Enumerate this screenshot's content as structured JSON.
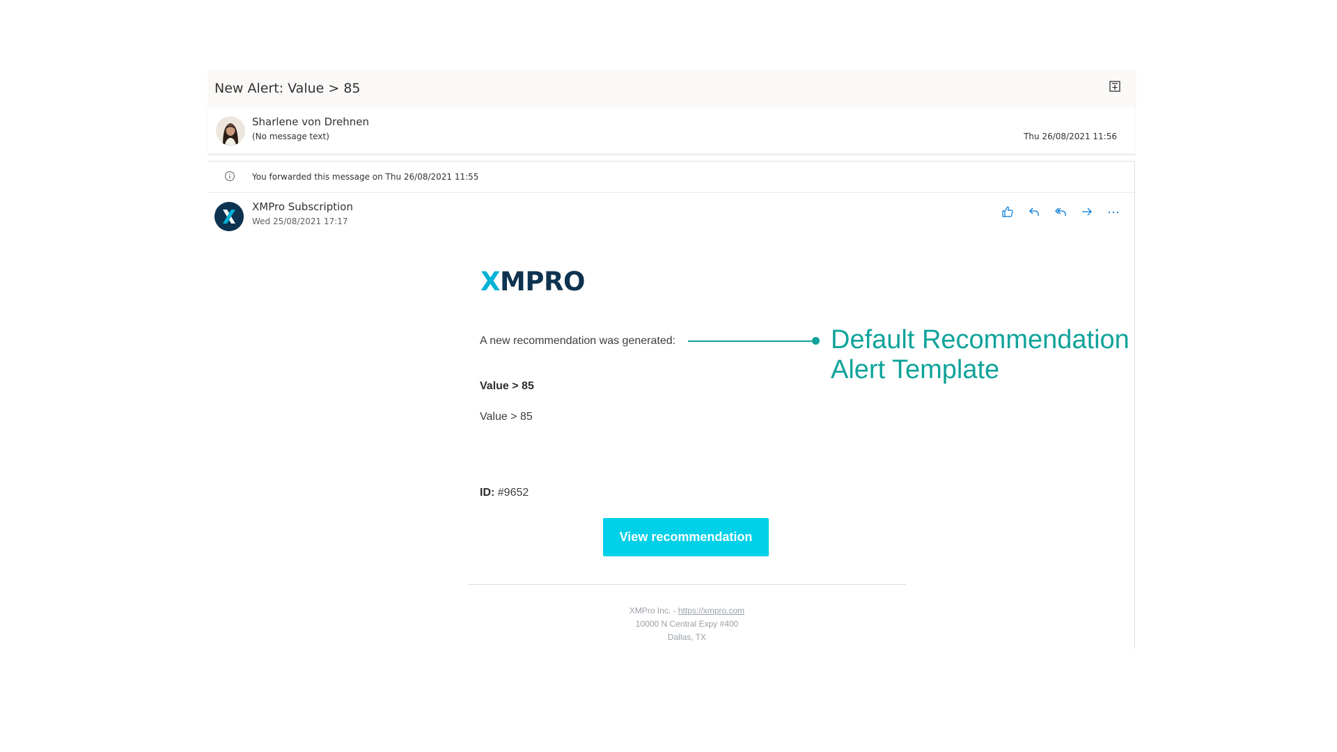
{
  "subject": "New Alert: Value > 85",
  "first_message": {
    "sender": "Sharlene von Drehnen",
    "preview": "(No message text)",
    "date": "Thu 26/08/2021 11:56"
  },
  "forward_info": "You forwarded this message on Thu 26/08/2021 11:55",
  "second_message": {
    "sender": "XMPro Subscription",
    "date": "Wed 25/08/2021 17:17",
    "avatar_letter": "X",
    "actions": [
      "like-icon",
      "reply-icon",
      "reply-all-icon",
      "forward-icon",
      "more-icon"
    ]
  },
  "email": {
    "logo_x": "X",
    "logo_rest": "MPRO",
    "intro": "A new recommendation was generated:",
    "title": "Value > 85",
    "description": "Value > 85",
    "id_label": "ID:",
    "id_value": "#9652",
    "button_label": "View recommendation",
    "footer": {
      "company": "XMPro Inc. - ",
      "link": "https://xmpro.com",
      "address": "10000 N Central Expy #400",
      "city": "Dallas, TX"
    }
  },
  "annotation": {
    "line1": "Default Recommendation",
    "line2": "Alert Template"
  },
  "colors": {
    "accent_teal": "#0fa39a",
    "button_cyan": "#00d0e8",
    "brand_navy": "#0d3350",
    "brand_cyan": "#00b2d6",
    "action_blue": "#0078d4"
  }
}
